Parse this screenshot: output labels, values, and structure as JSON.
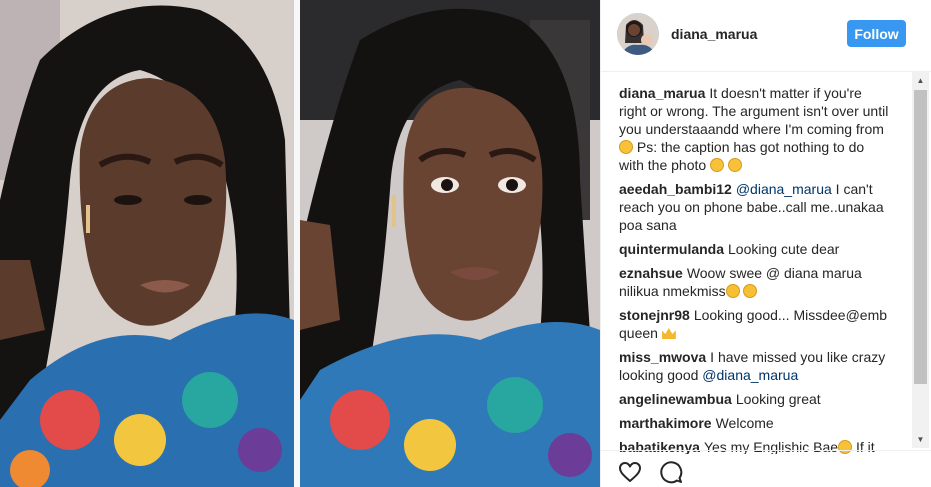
{
  "header": {
    "username": "diana_marua",
    "follow_label": "Follow"
  },
  "comments": [
    {
      "user": "diana_marua",
      "text": "It doesn't matter if you're right or wrong. The argument isn't over until you understaaandd where I'm coming from",
      "text2": "Ps: the caption has got nothing to do with the photo"
    },
    {
      "user": "aeedah_bambi12",
      "mention": "@diana_marua",
      "text": "I can't reach you on phone babe..call me..unakaa poa sana"
    },
    {
      "user": "quintermulanda",
      "text": "Looking cute dear"
    },
    {
      "user": "eznahsue",
      "text": "Woow swee @ diana marua nilikua nmekmiss"
    },
    {
      "user": "stonejnr98",
      "text": "Looking good... Missdee@emb queen"
    },
    {
      "user": "miss_mwova",
      "text": "I have missed you like crazy looking good",
      "mention": "@diana_marua"
    },
    {
      "user": "angelinewambua",
      "text": "Looking great"
    },
    {
      "user": "marthakimore",
      "text": "Welcome"
    },
    {
      "user": "babatikenya",
      "text": "Yes my Englishic Bae",
      "text2": "If it"
    }
  ],
  "icons": {
    "like": "heart-icon",
    "comment": "comment-icon",
    "scroll_up": "scroll-up-arrow-icon",
    "scroll_down": "scroll-down-arrow-icon"
  },
  "colors": {
    "follow_button": "#3897f0",
    "username_text": "#262626",
    "mention": "#003569",
    "divider": "#efefef"
  }
}
